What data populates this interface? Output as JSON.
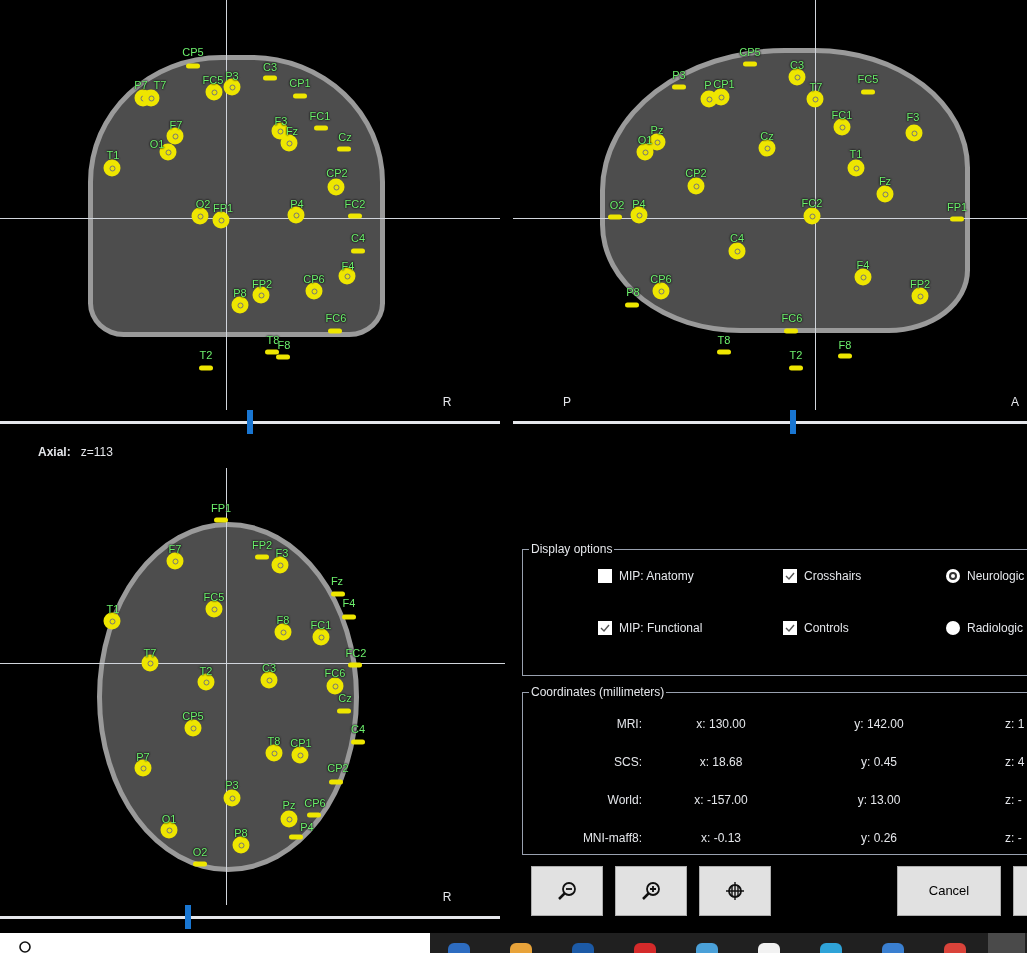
{
  "views": [
    {
      "kind": "coronal",
      "corner_labels": [
        "R"
      ],
      "slider": {
        "level": 0.5
      },
      "electrodes": [
        {
          "label": "CP5"
        },
        {
          "label": "C3"
        },
        {
          "label": "P7"
        },
        {
          "label": "T7"
        },
        {
          "label": "FC5"
        },
        {
          "label": "P3"
        },
        {
          "label": "CP1"
        },
        {
          "label": "FC1"
        },
        {
          "label": "F3"
        },
        {
          "label": "Fz"
        },
        {
          "label": "Cz"
        },
        {
          "label": "F7"
        },
        {
          "label": "O1"
        },
        {
          "label": "T1"
        },
        {
          "label": "CP2"
        },
        {
          "label": "O2"
        },
        {
          "label": "FP1"
        },
        {
          "label": "P4"
        },
        {
          "label": "FC2"
        },
        {
          "label": "C4"
        },
        {
          "label": "F4"
        },
        {
          "label": "CP6"
        },
        {
          "label": "FP2"
        },
        {
          "label": "P8"
        },
        {
          "label": "FC6"
        },
        {
          "label": "T8"
        },
        {
          "label": "F8"
        },
        {
          "label": "T2"
        }
      ]
    },
    {
      "kind": "sagittal",
      "corner_labels": [
        "P",
        "A"
      ],
      "slider": {
        "level": 0.545
      },
      "electrodes": [
        {
          "label": "CP5"
        },
        {
          "label": "C3"
        },
        {
          "label": "P3"
        },
        {
          "label": "FC5"
        },
        {
          "label": "P"
        },
        {
          "label": "CP1"
        },
        {
          "label": "T7"
        },
        {
          "label": "FC1"
        },
        {
          "label": "F3"
        },
        {
          "label": "Pz"
        },
        {
          "label": "O1"
        },
        {
          "label": "Cz"
        },
        {
          "label": "T1"
        },
        {
          "label": "CP2"
        },
        {
          "label": "Fz"
        },
        {
          "label": "O2"
        },
        {
          "label": "P4"
        },
        {
          "label": "FC2"
        },
        {
          "label": "FP1"
        },
        {
          "label": "C4"
        },
        {
          "label": "F4"
        },
        {
          "label": "CP6"
        },
        {
          "label": "FP2"
        },
        {
          "label": "P8"
        },
        {
          "label": "FC6"
        },
        {
          "label": "T8"
        },
        {
          "label": "F8"
        },
        {
          "label": "T2"
        }
      ]
    },
    {
      "kind": "axial",
      "title": "Axial:",
      "position": "z=113",
      "corner_labels": [
        "R"
      ],
      "slider": {
        "level": 0.376
      },
      "electrodes": [
        {
          "label": "FP1"
        },
        {
          "label": "F7"
        },
        {
          "label": "FP2"
        },
        {
          "label": "F3"
        },
        {
          "label": "Fz"
        },
        {
          "label": "T1"
        },
        {
          "label": "FC5"
        },
        {
          "label": "F4"
        },
        {
          "label": "F8"
        },
        {
          "label": "FC1"
        },
        {
          "label": "FC2"
        },
        {
          "label": "T7"
        },
        {
          "label": "T2"
        },
        {
          "label": "C3"
        },
        {
          "label": "FC6"
        },
        {
          "label": "Cz"
        },
        {
          "label": "CP5"
        },
        {
          "label": "C4"
        },
        {
          "label": "T8"
        },
        {
          "label": "CP1"
        },
        {
          "label": "P7"
        },
        {
          "label": "CP2"
        },
        {
          "label": "P3"
        },
        {
          "label": "Pz"
        },
        {
          "label": "CP6"
        },
        {
          "label": "O1"
        },
        {
          "label": "P4"
        },
        {
          "label": "P8"
        },
        {
          "label": "O2"
        }
      ]
    }
  ],
  "display_options": {
    "title": "Display options",
    "items": [
      {
        "kind": "checkbox",
        "label": "MIP: Anatomy",
        "checked": false
      },
      {
        "kind": "checkbox",
        "label": "Crosshairs",
        "checked": true
      },
      {
        "kind": "radio",
        "label": "Neurologic",
        "selected": true
      },
      {
        "kind": "checkbox",
        "label": "MIP: Functional",
        "checked": true
      },
      {
        "kind": "checkbox",
        "label": "Controls",
        "checked": true
      },
      {
        "kind": "radio",
        "label": "Radiologic",
        "selected": false
      }
    ]
  },
  "coordinates": {
    "title": "Coordinates (millimeters)",
    "rows": [
      {
        "label": "MRI:",
        "x": "x: 130.00",
        "y": "y: 142.00",
        "z": "z: 1"
      },
      {
        "label": "SCS:",
        "x": "x: 18.68",
        "y": "y: 0.45",
        "z": "z: 4"
      },
      {
        "label": "World:",
        "x": "x: -157.00",
        "y": "y: 13.00",
        "z": "z: -"
      },
      {
        "label": "MNI-maff8:",
        "x": "x: -0.13",
        "y": "y: 0.26",
        "z": "z: -"
      }
    ]
  },
  "buttons": [
    {
      "kind": "zoom_out"
    },
    {
      "kind": "zoom_in"
    },
    {
      "kind": "crosshair"
    },
    {
      "kind": "text",
      "label": "Cancel"
    },
    {
      "kind": "cut"
    }
  ]
}
